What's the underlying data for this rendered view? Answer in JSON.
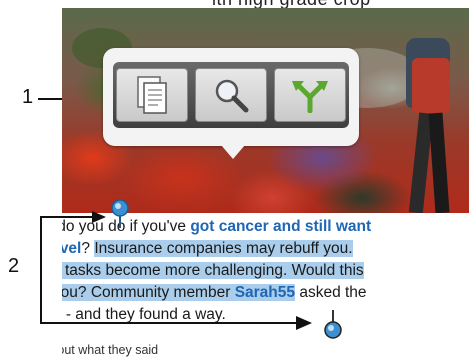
{
  "toolbar": {
    "buttons": [
      {
        "name": "copy",
        "icon": "copy-icon"
      },
      {
        "name": "search",
        "icon": "magnifier-icon"
      },
      {
        "name": "share",
        "icon": "share-icon"
      }
    ]
  },
  "article": {
    "line1_a": "at do you do if you've ",
    "line1_b": "got cancer and still want",
    "line2_a": "travel",
    "line2_b": "? ",
    "line2_c": "Insurance companies may rebuff you.",
    "line3": "ple tasks become more challenging. Would this",
    "line4_a": "p you? Community member ",
    "line4_b": "Sarah55",
    "line4_c": " asked the",
    "line5": "um - and they found a way.",
    "line6": "nd out what they said"
  },
  "callouts": {
    "one": "1",
    "two": "2"
  },
  "colors": {
    "selection": "#a9cdeb",
    "link": "#1f66b5",
    "handle": "#3d8fd1"
  }
}
